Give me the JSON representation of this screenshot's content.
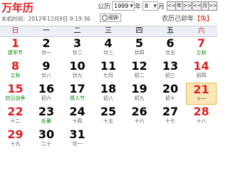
{
  "title": "万年历",
  "controls": {
    "gregorian_label": "公历",
    "year_value": "1999",
    "year_unit": "年",
    "month_value": "8",
    "month_unit": "月",
    "nav": [
      "<<",
      "年",
      ">>",
      "<<",
      "月",
      ">>"
    ]
  },
  "local_time": "本机时间：2012年12月9日 9:19:36",
  "clock_label": "闹钟",
  "lunar_header": "农历己卯年",
  "zodiac": "【兔】",
  "weekdays": [
    "日",
    "一",
    "二",
    "三",
    "四",
    "五",
    "六"
  ],
  "colors": {
    "weekend": "#d22222",
    "festival": "#0a8a0a",
    "today_bg": "#fbe6b8"
  },
  "weeks": [
    [
      {
        "d": "1",
        "l": "建军节",
        "f": true
      },
      {
        "d": "2",
        "l": "廿一"
      },
      {
        "d": "3",
        "l": "廿二"
      },
      {
        "d": "4",
        "l": "廿三"
      },
      {
        "d": "5",
        "l": "廿四"
      },
      {
        "d": "6",
        "l": "廿五"
      },
      {
        "d": "7",
        "l": "立秋",
        "f": true
      }
    ],
    [
      {
        "d": "8",
        "l": "立秋",
        "f": true
      },
      {
        "d": "9",
        "l": "廿八"
      },
      {
        "d": "10",
        "l": "廿九"
      },
      {
        "d": "11",
        "l": "七月"
      },
      {
        "d": "12",
        "l": "初二"
      },
      {
        "d": "13",
        "l": "初三"
      },
      {
        "d": "14",
        "l": "初四"
      }
    ],
    [
      {
        "d": "15",
        "l": "抗日战争",
        "f": true
      },
      {
        "d": "16",
        "l": "初六"
      },
      {
        "d": "17",
        "l": "情人节",
        "f": true
      },
      {
        "d": "18",
        "l": "初八"
      },
      {
        "d": "19",
        "l": "初九"
      },
      {
        "d": "20",
        "l": "初十"
      },
      {
        "d": "21",
        "l": "十一",
        "today": true
      }
    ],
    [
      {
        "d": "22",
        "l": "十二"
      },
      {
        "d": "23",
        "l": "处暑",
        "f": true
      },
      {
        "d": "24",
        "l": "十四"
      },
      {
        "d": "25",
        "l": "十五"
      },
      {
        "d": "26",
        "l": "十六"
      },
      {
        "d": "27",
        "l": "十七"
      },
      {
        "d": "28",
        "l": "十八"
      }
    ],
    [
      {
        "d": "29",
        "l": "十九"
      },
      {
        "d": "30",
        "l": "二十"
      },
      {
        "d": "31",
        "l": "廿一"
      }
    ]
  ]
}
